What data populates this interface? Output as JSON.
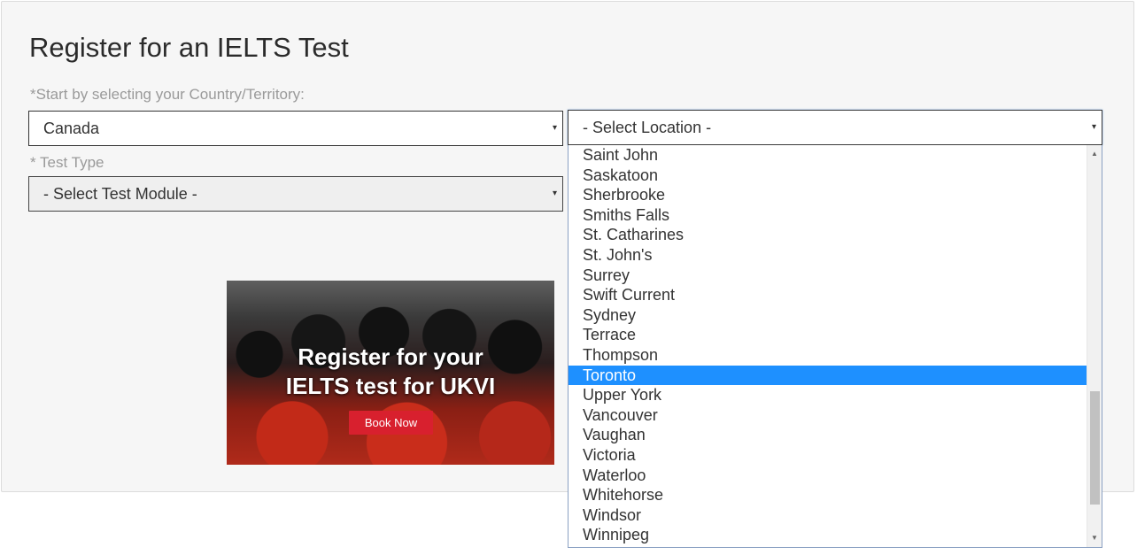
{
  "page": {
    "title": "Register for an IELTS Test",
    "country_label": "*Start by selecting your Country/Territory:",
    "test_type_label": "* Test Type"
  },
  "country_select": {
    "value": "Canada"
  },
  "location_select": {
    "value": "- Select Location -",
    "options": [
      "Saint John",
      "Saskatoon",
      "Sherbrooke",
      "Smiths Falls",
      "St. Catharines",
      "St. John's",
      "Surrey",
      "Swift Current",
      "Sydney",
      "Terrace",
      "Thompson",
      "Toronto",
      "Upper York",
      "Vancouver",
      "Vaughan",
      "Victoria",
      "Waterloo",
      "Whitehorse",
      "Windsor",
      "Winnipeg"
    ],
    "highlighted": "Toronto",
    "scroll_position": 0.9
  },
  "module_select": {
    "value": "- Select Test Module -"
  },
  "banner": {
    "headline_line1": "Register for your",
    "headline_line2": "IELTS test for UKVI",
    "button_label": "Book Now"
  },
  "icons": {
    "dropdown_arrow": "▾",
    "scroll_up": "▲",
    "scroll_down": "▼"
  },
  "colors": {
    "highlight": "#1e90ff",
    "book_button": "#d8202e",
    "panel_bg": "#f6f6f6"
  }
}
